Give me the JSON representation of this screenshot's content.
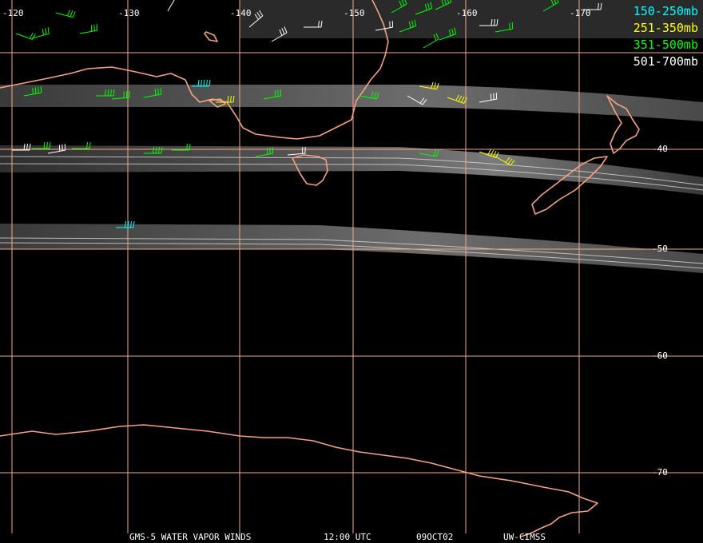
{
  "map": {
    "longitude_labels": [
      "-120",
      "-130",
      "-140",
      "-150",
      "-160",
      "-170"
    ],
    "latitude_labels": [
      "-40",
      "-50",
      "-60",
      "-70"
    ],
    "colors": {
      "background": "#000000",
      "grid": "#f4a88a",
      "coastline": "#f4a27e",
      "label": "#ffffff"
    }
  },
  "legend": {
    "items": [
      {
        "label": "150-250mb",
        "color": "#00ffff"
      },
      {
        "label": "251-350mb",
        "color": "#ffff00"
      },
      {
        "label": "351-500mb",
        "color": "#00ff00"
      },
      {
        "label": "501-700mb",
        "color": "#ffffff"
      }
    ]
  },
  "footer": {
    "product": "GMS-5 WATER VAPOR WINDS",
    "time": "12:00 UTC",
    "date": "09OCT02",
    "source": "UW-CIMSS"
  }
}
